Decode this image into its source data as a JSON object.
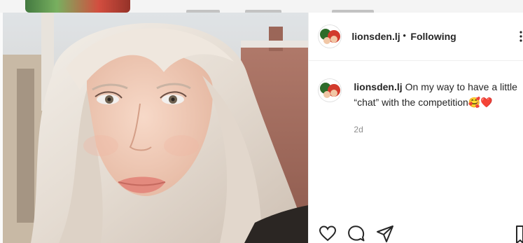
{
  "post": {
    "username": "lionsden.lj",
    "separator": "•",
    "follow_status": "Following",
    "caption_text": "On my way to have a little “chat” with the competition🥰❤️",
    "time": "2d"
  },
  "icons": {
    "more": "more-options-icon",
    "like": "heart-icon",
    "comment": "comment-icon",
    "share": "share-icon",
    "save": "bookmark-icon"
  },
  "colors": {
    "text": "#262626",
    "muted": "#8e8e8e",
    "divider": "#efefef"
  }
}
